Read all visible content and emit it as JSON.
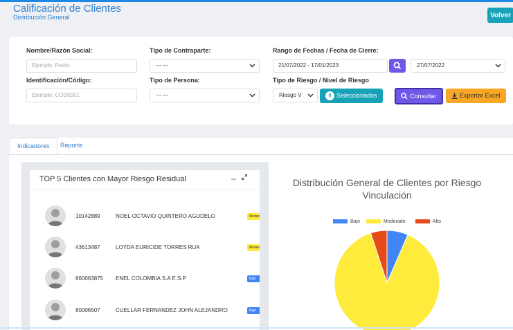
{
  "header": {
    "title": "Calificación de Clientes",
    "subtitle": "Distribución General",
    "back_button": "Volver"
  },
  "filters": {
    "name_label": "Nombre/Razón Social:",
    "name_placeholder": "Ejemplo: Pedro",
    "code_label": "Identificación/Código:",
    "code_placeholder": "Ejemplo: COD0001",
    "counterpart_label": "Tipo de Contraparte:",
    "counterpart_value": "--- ---",
    "person_label": "Tipo de Persona:",
    "person_value": "--- ---",
    "date_label": "Rango de Fechas / Fecha de Cierre:",
    "date_range": "21/07/2022 - 17/01/2023",
    "close_date": "27/07/2022",
    "risk_label": "Tipo de Riesgo / Nivel de Riesgo",
    "risk_value": "Riesgo V",
    "selected_count": "0",
    "selected_label": "Seleccionados",
    "consult_button": "Consultar",
    "export_button": "Exportar Excel"
  },
  "tabs": [
    {
      "label": "Indicadores",
      "active": true
    },
    {
      "label": "Reporte",
      "active": false
    }
  ],
  "top_clients": {
    "title": "TOP 5 Clientes con Mayor Riesgo Residual",
    "rows": [
      {
        "id": "10142889",
        "name": "NOEL OCTAVIO QUINTERO AGUDELO",
        "level": "Moderado",
        "color": "#ffeb3b"
      },
      {
        "id": "43613487",
        "name": "LOYDA EURICIDE TORRES RUA",
        "level": "Moderado",
        "color": "#ffeb3b"
      },
      {
        "id": "860063875",
        "name": "ENEL COLOMBIA S.A E.S.P",
        "level": "Bajo",
        "color": "#4285f4"
      },
      {
        "id": "80006507",
        "name": "CUELLAR FERNANDEZ JOHN ALEJANDRO",
        "level": "Bajo",
        "color": "#4285f4"
      }
    ]
  },
  "chart_data": {
    "type": "pie",
    "title": "Distribución General de Clientes por Riesgo Vinculación",
    "categories": [
      "Bajo",
      "Moderado",
      "Alto"
    ],
    "values": [
      6.5,
      88.5,
      5
    ],
    "colors": [
      "#4285f4",
      "#ffeb3b",
      "#e64a19"
    ],
    "legend_position": "top"
  }
}
